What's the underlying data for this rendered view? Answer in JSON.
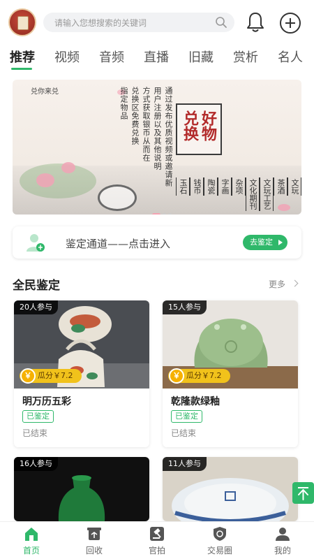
{
  "header": {
    "search_placeholder": "请输入您想搜索的关键词"
  },
  "tabs": [
    {
      "label": "推荐",
      "active": true
    },
    {
      "label": "视频"
    },
    {
      "label": "音频"
    },
    {
      "label": "直播"
    },
    {
      "label": "旧藏"
    },
    {
      "label": "赏析"
    },
    {
      "label": "名人"
    }
  ],
  "banner": {
    "brand": "兑你来兑",
    "title_line1": "好物",
    "title_line2": "兑换",
    "description": [
      "通过发布优质视频或邀请新",
      "用户注册以及其他说明",
      "方式获取银币从而在",
      "兑换区免费兑换",
      "指定物品"
    ],
    "categories": [
      "文玩",
      "茶酒",
      "文玩工艺",
      "文化期刊",
      "杂项",
      "字画",
      "陶瓷",
      "钱币",
      "玉石"
    ]
  },
  "appraise_entry": {
    "text": "鉴定通道——点击进入",
    "button": "去鉴定"
  },
  "section": {
    "title": "全民鉴定",
    "more": "更多"
  },
  "cards": [
    {
      "participants": "20人参与",
      "reward": "瓜分￥7.2",
      "name": "明万历五彩",
      "tag": "已鉴定",
      "status": "已结束"
    },
    {
      "participants": "15人参与",
      "reward": "瓜分￥7.2",
      "name": "乾隆款绿釉",
      "tag": "已鉴定",
      "status": "已结束"
    },
    {
      "participants": "16人参与"
    },
    {
      "participants": "11人参与"
    }
  ],
  "bottom_nav": [
    {
      "label": "首页",
      "icon": "home-icon",
      "active": true
    },
    {
      "label": "回收",
      "icon": "recycle-icon"
    },
    {
      "label": "官拍",
      "icon": "gavel-icon"
    },
    {
      "label": "交易圈",
      "icon": "shield-trade-icon"
    },
    {
      "label": "我的",
      "icon": "user-icon"
    }
  ],
  "colors": {
    "accent": "#2fb86a",
    "reward": "#f1c21b",
    "banner_title": "#b22a2a"
  }
}
